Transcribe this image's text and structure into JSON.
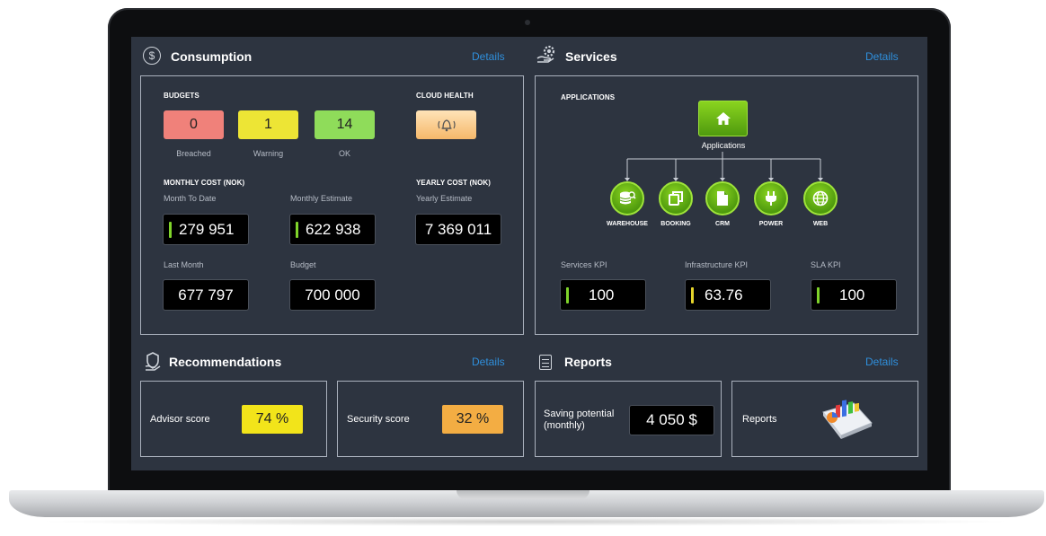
{
  "consumption": {
    "title": "Consumption",
    "details": "Details",
    "budgets_label": "BUDGETS",
    "budgets": [
      {
        "value": "0",
        "label": "Breached",
        "color": "#f0817a"
      },
      {
        "value": "1",
        "label": "Warning",
        "color": "#ede535"
      },
      {
        "value": "14",
        "label": "OK",
        "color": "#8fdc5a"
      }
    ],
    "cloud_health_label": "CLOUD HEALTH",
    "cloud_health_icon": "alarm-bell-icon",
    "monthly_cost_label": "MONTHLY COST (NOK)",
    "yearly_cost_label": "YEARLY COST (NOK)",
    "month_to_date_label": "Month To Date",
    "month_to_date_value": "279 951",
    "monthly_estimate_label": "Monthly Estimate",
    "monthly_estimate_value": "622 938",
    "yearly_estimate_label": "Yearly Estimate",
    "yearly_estimate_value": "7 369 011",
    "last_month_label": "Last Month",
    "last_month_value": "677 797",
    "budget_label": "Budget",
    "budget_value": "700 000"
  },
  "services": {
    "title": "Services",
    "details": "Details",
    "applications_label": "APPLICATIONS",
    "root_label": "Applications",
    "nodes": [
      {
        "label": "WAREHOUSE",
        "icon": "database-search-icon"
      },
      {
        "label": "BOOKING",
        "icon": "copy-icon"
      },
      {
        "label": "CRM",
        "icon": "document-icon"
      },
      {
        "label": "POWER",
        "icon": "plug-icon"
      },
      {
        "label": "WEB",
        "icon": "globe-icon"
      }
    ],
    "kpis": [
      {
        "label": "Services KPI",
        "value": "100",
        "bar_color": "#7fd32a"
      },
      {
        "label": "Infrastructure KPI",
        "value": "63.76",
        "bar_color": "#e4d42b"
      },
      {
        "label": "SLA KPI",
        "value": "100",
        "bar_color": "#7fd32a"
      }
    ]
  },
  "recommendations": {
    "title": "Recommendations",
    "details": "Details",
    "advisor_label": "Advisor score",
    "advisor_value": "74 %",
    "advisor_color": "#f2e41a",
    "security_label": "Security score",
    "security_value": "32 %",
    "security_color": "#f3ad43"
  },
  "reports": {
    "title": "Reports",
    "details": "Details",
    "saving_label": "Saving potential (monthly)",
    "saving_value": "4 050 $",
    "reports_label": "Reports"
  },
  "colors": {
    "screen_bg": "#2d3440",
    "link": "#2f8fdc",
    "green": "#7fd32a"
  }
}
